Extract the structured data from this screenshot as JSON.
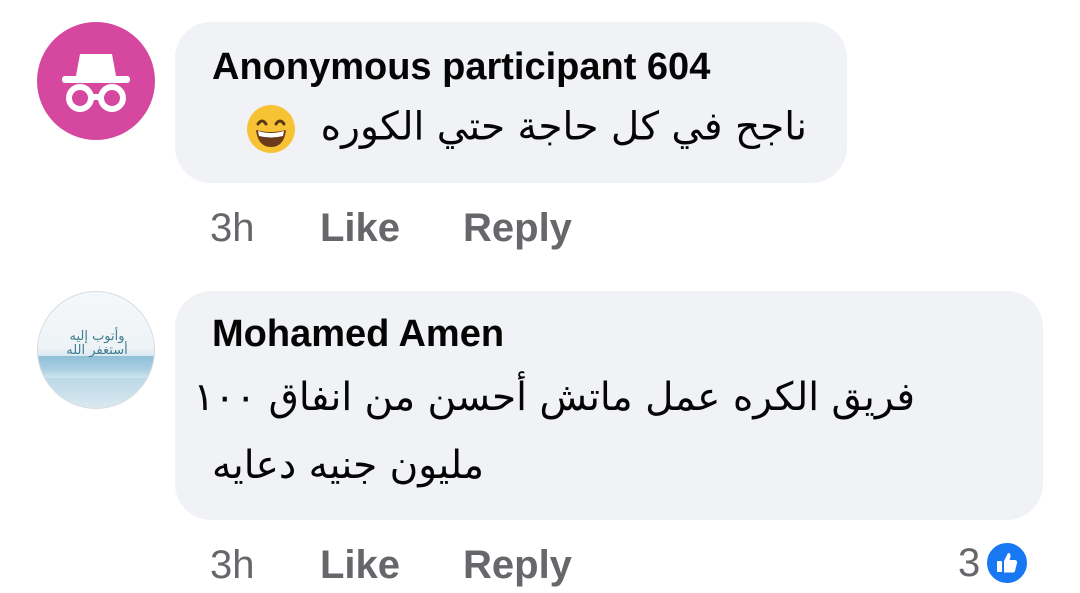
{
  "comments": [
    {
      "author": "Anonymous participant 604",
      "avatar_icon": "incognito-icon",
      "avatar_color": "#d6479f",
      "text": "ناجح في كل حاجة حتي الكوره",
      "emoji": "grinning-face-icon",
      "time": "3h",
      "like_label": "Like",
      "reply_label": "Reply"
    },
    {
      "author": "Mohamed Amen",
      "avatar_text": "وأتوب إليه أستغفر الله",
      "text_line1": "فريق الكره عمل ماتش أحسن من انفاق ١٠٠",
      "text_line2": "مليون جنيه دعايه",
      "time": "3h",
      "like_label": "Like",
      "reply_label": "Reply",
      "reaction_count": "3",
      "reaction_icon": "thumbs-up-icon",
      "reaction_color": "#1877f2"
    }
  ]
}
